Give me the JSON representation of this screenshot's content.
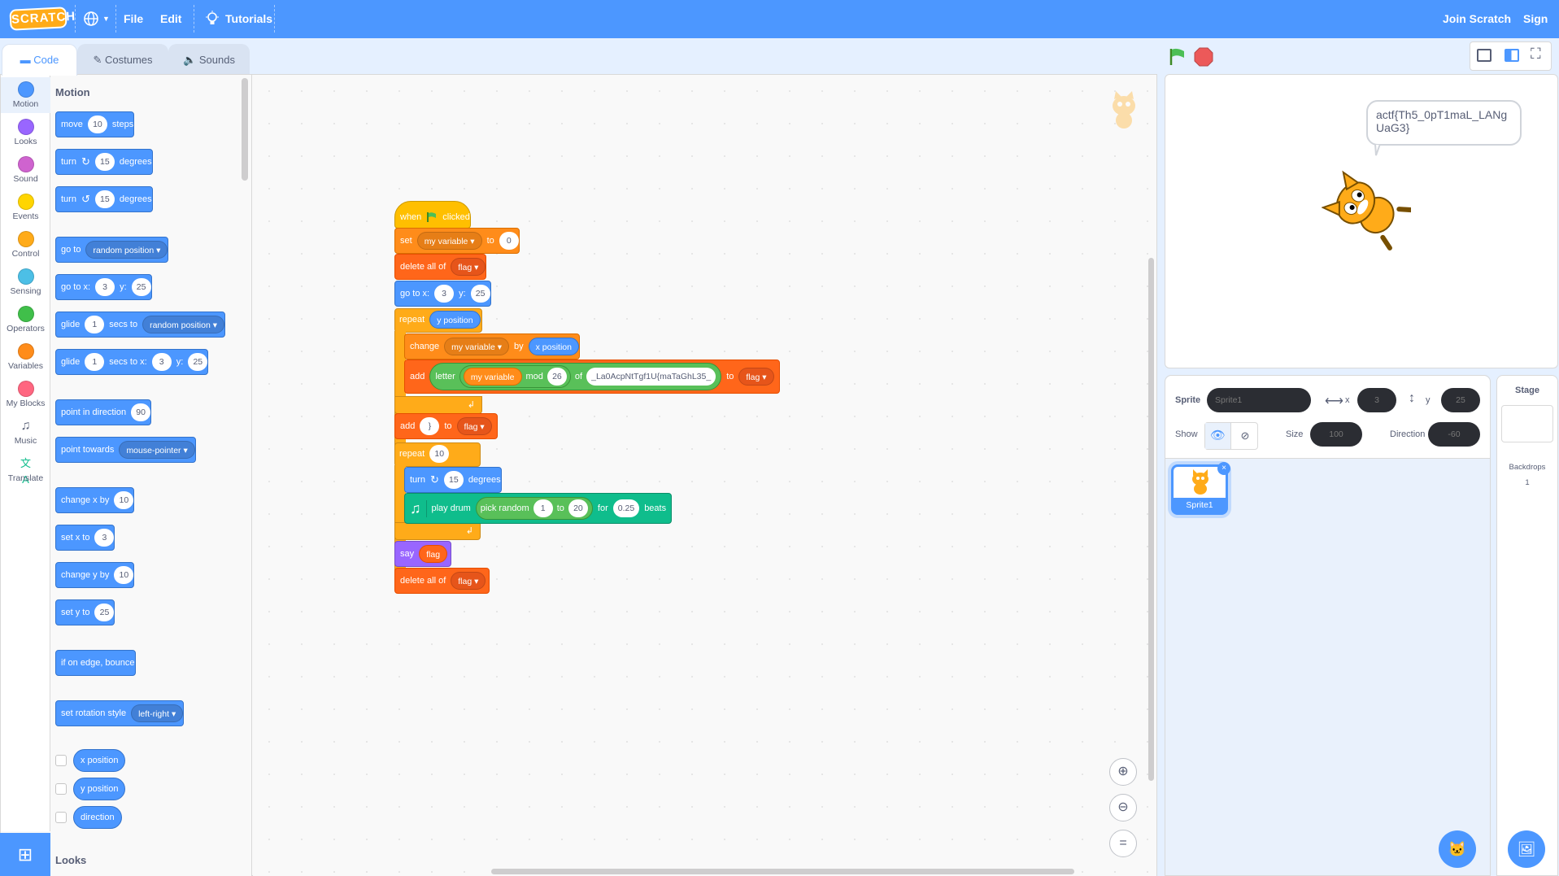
{
  "menubar": {
    "logo": "SCRATCH",
    "file": "File",
    "edit": "Edit",
    "tutorials": "Tutorials",
    "join": "Join Scratch",
    "signin": "Sign in"
  },
  "tabs": {
    "code": "Code",
    "costumes": "Costumes",
    "sounds": "Sounds"
  },
  "categories": [
    {
      "label": "Motion",
      "color": "#4c97ff"
    },
    {
      "label": "Looks",
      "color": "#9966ff"
    },
    {
      "label": "Sound",
      "color": "#cf63cf"
    },
    {
      "label": "Events",
      "color": "#ffd500"
    },
    {
      "label": "Control",
      "color": "#ffab19"
    },
    {
      "label": "Sensing",
      "color": "#4cbfe6"
    },
    {
      "label": "Operators",
      "color": "#40bf4a"
    },
    {
      "label": "Variables",
      "color": "#ff8c1a"
    },
    {
      "label": "My Blocks",
      "color": "#ff6680"
    },
    {
      "label": "Music",
      "color": ""
    },
    {
      "label": "Translate",
      "color": ""
    }
  ],
  "palette": {
    "heading": "Motion",
    "looks_heading": "Looks",
    "move": {
      "a": "move",
      "v": "10",
      "b": "steps"
    },
    "turn_cw": {
      "a": "turn",
      "v": "15",
      "b": "degrees"
    },
    "turn_ccw": {
      "a": "turn",
      "v": "15",
      "b": "degrees"
    },
    "goto": {
      "a": "go to",
      "d": "random position"
    },
    "gotoxy": {
      "a": "go to x:",
      "x": "3",
      "ylabel": "y:",
      "y": "25"
    },
    "glide_to": {
      "a": "glide",
      "v": "1",
      "b": "secs to",
      "d": "random position"
    },
    "glide_xy": {
      "a": "glide",
      "v": "1",
      "b": "secs to x:",
      "x": "3",
      "ylabel": "y:",
      "y": "25"
    },
    "point_dir": {
      "a": "point in direction",
      "v": "90"
    },
    "point_towards": {
      "a": "point towards",
      "d": "mouse-pointer"
    },
    "change_x": {
      "a": "change x by",
      "v": "10"
    },
    "set_x": {
      "a": "set x to",
      "v": "3"
    },
    "change_y": {
      "a": "change y by",
      "v": "10"
    },
    "set_y": {
      "a": "set y to",
      "v": "25"
    },
    "bounce": "if on edge, bounce",
    "rot_style": {
      "a": "set rotation style",
      "d": "left-right"
    },
    "reporters": [
      "x position",
      "y position",
      "direction"
    ]
  },
  "script": {
    "hat": {
      "a": "when",
      "b": "clicked"
    },
    "set": {
      "a": "set",
      "var": "my variable",
      "b": "to",
      "v": "0"
    },
    "delete1": {
      "a": "delete all of",
      "list": "flag"
    },
    "gotoxy": {
      "a": "go to x:",
      "x": "3",
      "ylabel": "y:",
      "y": "25"
    },
    "repeat1": {
      "a": "repeat",
      "v": "y position"
    },
    "change": {
      "a": "change",
      "var": "my variable",
      "b": "by",
      "v": "x position"
    },
    "add1": {
      "a": "add",
      "letter": "letter",
      "var": "my variable",
      "mod": "mod",
      "n": "26",
      "of": "of",
      "str": "_La0AcpNtTgf1U{maTaGhL35_",
      "to": "to",
      "list": "flag"
    },
    "add2": {
      "a": "add",
      "v": "}",
      "to": "to",
      "list": "flag"
    },
    "repeat2": {
      "a": "repeat",
      "v": "10"
    },
    "turn": {
      "a": "turn",
      "v": "15",
      "b": "degrees"
    },
    "drum": {
      "a": "play drum",
      "pick": "pick random",
      "v1": "1",
      "to": "to",
      "v2": "20",
      "for": "for",
      "beats_v": "0.25",
      "beats": "beats"
    },
    "say": {
      "a": "say",
      "v": "flag"
    },
    "delete2": {
      "a": "delete all of",
      "list": "flag"
    }
  },
  "stage": {
    "speech": "actf{Th5_0pT1maL_LANgUaG3}"
  },
  "sprite_info": {
    "sprite_label": "Sprite",
    "sprite_name": "Sprite1",
    "x_label": "x",
    "x": "3",
    "y_label": "y",
    "y": "25",
    "show_label": "Show",
    "size_label": "Size",
    "size": "100",
    "direction_label": "Direction",
    "direction": "-60"
  },
  "sprites": [
    {
      "name": "Sprite1"
    }
  ],
  "stage_pane": {
    "title": "Stage",
    "backdrops_label": "Backdrops",
    "backdrops_count": "1"
  }
}
